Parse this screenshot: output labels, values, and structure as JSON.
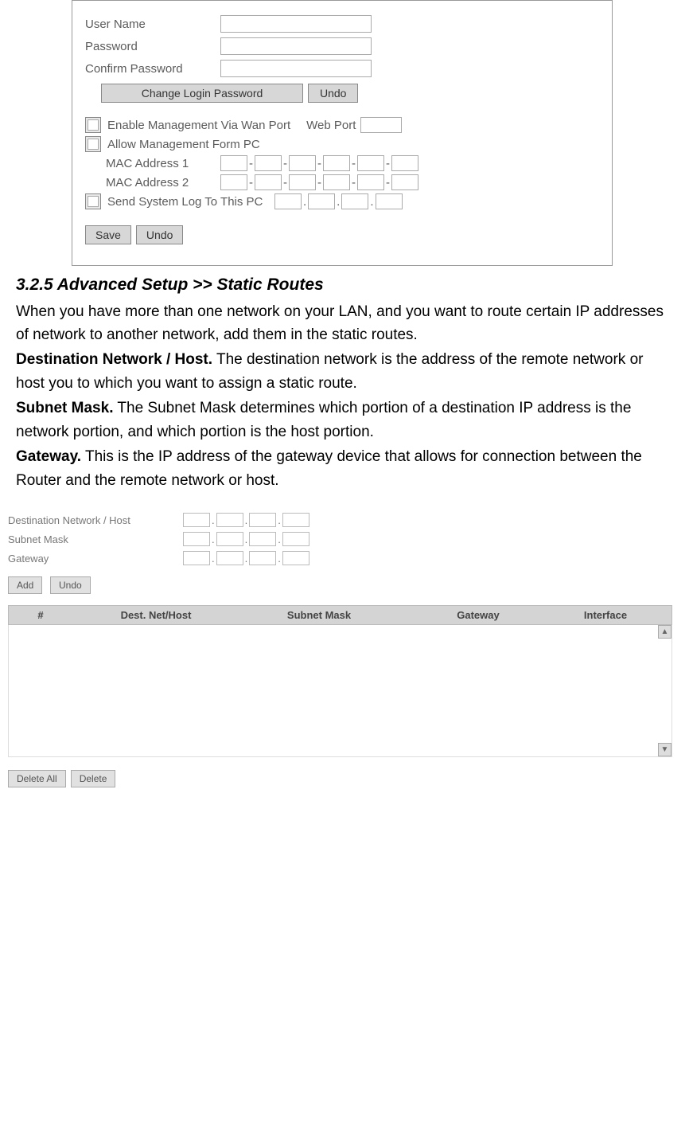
{
  "panel1": {
    "user_name_label": "User Name",
    "password_label": "Password",
    "confirm_password_label": "Confirm Password",
    "change_login_btn": "Change Login Password",
    "undo_btn": "Undo",
    "enable_mgmt_wan_label": "Enable Management Via Wan Port",
    "web_port_label": "Web Port",
    "allow_mgmt_pc_label": "Allow Management Form PC",
    "mac1_label": "MAC Address 1",
    "mac2_label": "MAC Address 2",
    "syslog_label": "Send System Log To This PC",
    "save_btn": "Save",
    "undo2_btn": "Undo"
  },
  "text": {
    "heading": "3.2.5 Advanced Setup >> Static Routes",
    "intro": "When you have more than one network on your LAN, and you want to route certain IP addresses of network to another network, add them in the static routes.",
    "dest_bold": "Destination Network / Host.",
    "dest_text": " The destination network is the address of the remote network or host you to which you want to assign a static route.",
    "mask_bold": "Subnet Mask.",
    "mask_text": " The Subnet Mask determines which portion of a destination IP address is the network portion, and which portion is the host portion.",
    "gw_bold": "Gateway.",
    "gw_text": " This is the IP address of the gateway device that allows for connection between the Router and the remote network or host."
  },
  "panel2": {
    "dest_label": "Destination Network / Host",
    "mask_label": "Subnet Mask",
    "gw_label": "Gateway",
    "add_btn": "Add",
    "undo_btn": "Undo",
    "col_num": "#",
    "col_dest": "Dest. Net/Host",
    "col_mask": "Subnet Mask",
    "col_gw": "Gateway",
    "col_if": "Interface",
    "delete_all_btn": "Delete All",
    "delete_btn": "Delete"
  }
}
